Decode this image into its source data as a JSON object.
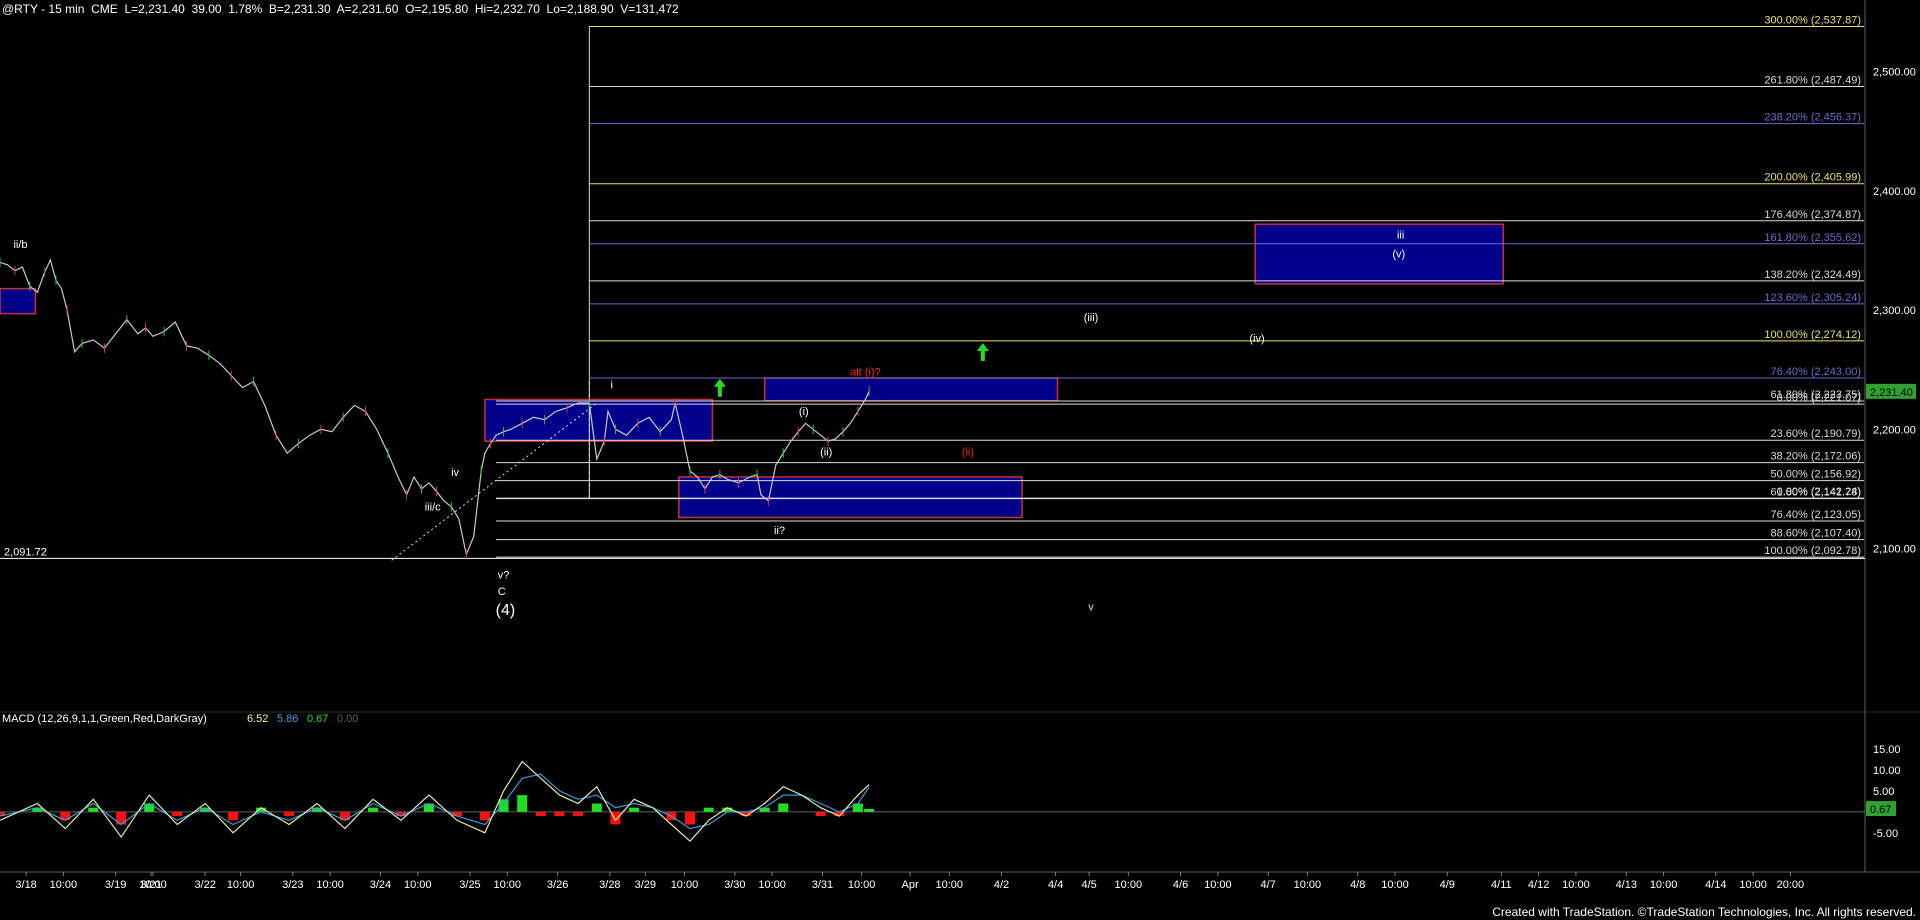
{
  "header": {
    "symbol": "@RTY - 15 min  CME",
    "last": "L=2,231.40",
    "change": "39.00",
    "change_pct": "1.78%",
    "bid": "B=2,231.30",
    "ask": "A=2,231.60",
    "open": "O=2,195.80",
    "high": "Hi=2,232.70",
    "low": "Lo=2,188.90",
    "volume": "V=131,472"
  },
  "footer_text": "Created with TradeStation. ©TradeStation Technologies, Inc. All rights reserved.",
  "colors": {
    "background": "#000000",
    "price_line": "#c8c8c8",
    "box_fill": "#00008b",
    "box_border": "#c83232",
    "fib_white": "#dcdcdc",
    "fib_blue": "#6a6ad0",
    "fib_yellow": "#e8e070",
    "green_arrow": "#22dd22",
    "macd_green": "#22dd22",
    "macd_red": "#ff1010",
    "macd_line": "#e8e8a0",
    "signal_line": "#30a0e0"
  },
  "chart_data": {
    "type": "line",
    "title": "",
    "xlabel": "",
    "ylabel": "",
    "ylim": [
      2040,
      2545
    ],
    "y_ticks": [
      "2,500.00",
      "2,400.00",
      "2,300.00",
      "2,200.00",
      "2,100.00"
    ],
    "y_tick_values": [
      2500,
      2400,
      2300,
      2200,
      2100
    ],
    "last_price_label": "2,231.40",
    "last_price": 2231.4,
    "x_tick_labels": [
      "3/18",
      "10:00",
      "3/19",
      "10:00",
      "3/21",
      "3/22",
      "10:00",
      "3/23",
      "10:00",
      "3/24",
      "10:00",
      "3/25",
      "10:00",
      "3/26",
      "3/28",
      "3/29",
      "10:00",
      "3/30",
      "10:00",
      "3/31",
      "10:00",
      "Apr",
      "10:00",
      "4/2",
      "4/4",
      "4/5",
      "10:00",
      "4/6",
      "10:00",
      "4/7",
      "10:00",
      "4/8",
      "10:00",
      "4/9",
      "4/11",
      "4/12",
      "10:00",
      "4/13",
      "10:00",
      "4/14",
      "10:00",
      "20:00"
    ],
    "x_tick_pos": [
      0.014,
      0.034,
      0.062,
      0.082,
      0.081,
      0.11,
      0.129,
      0.157,
      0.177,
      0.204,
      0.224,
      0.252,
      0.272,
      0.299,
      0.327,
      0.346,
      0.367,
      0.394,
      0.414,
      0.441,
      0.462,
      0.488,
      0.509,
      0.537,
      0.566,
      0.584,
      0.605,
      0.633,
      0.653,
      0.68,
      0.701,
      0.728,
      0.748,
      0.776,
      0.805,
      0.825,
      0.845,
      0.872,
      0.892,
      0.92,
      0.94,
      0.96
    ],
    "price_x": [
      0,
      0.004,
      0.008,
      0.012,
      0.016,
      0.02,
      0.024,
      0.027,
      0.03,
      0.033,
      0.036,
      0.04,
      0.044,
      0.05,
      0.056,
      0.062,
      0.068,
      0.074,
      0.078,
      0.082,
      0.088,
      0.094,
      0.1,
      0.106,
      0.112,
      0.118,
      0.124,
      0.13,
      0.136,
      0.142,
      0.148,
      0.154,
      0.16,
      0.166,
      0.172,
      0.178,
      0.184,
      0.19,
      0.196,
      0.202,
      0.208,
      0.214,
      0.218,
      0.222,
      0.226,
      0.23,
      0.234,
      0.238,
      0.242,
      0.246,
      0.25,
      0.254,
      0.258,
      0.26,
      0.263,
      0.266,
      0.27,
      0.274,
      0.28,
      0.286,
      0.292,
      0.298,
      0.304,
      0.31,
      0.316,
      0.32,
      0.324,
      0.326,
      0.33,
      0.336,
      0.342,
      0.348,
      0.354,
      0.36,
      0.362,
      0.366,
      0.37,
      0.374,
      0.378,
      0.382,
      0.386,
      0.39,
      0.396,
      0.402,
      0.406,
      0.408,
      0.412,
      0.416,
      0.42,
      0.424,
      0.428,
      0.432,
      0.436,
      0.44,
      0.444,
      0.448,
      0.452,
      0.456,
      0.46,
      0.464,
      0.466
    ],
    "price_y": [
      2340,
      2338,
      2333,
      2336,
      2320,
      2315,
      2332,
      2342,
      2325,
      2318,
      2300,
      2265,
      2272,
      2275,
      2268,
      2280,
      2292,
      2280,
      2285,
      2278,
      2282,
      2290,
      2270,
      2268,
      2262,
      2255,
      2245,
      2235,
      2240,
      2220,
      2195,
      2180,
      2188,
      2195,
      2200,
      2198,
      2210,
      2220,
      2215,
      2200,
      2180,
      2158,
      2145,
      2160,
      2150,
      2155,
      2148,
      2140,
      2135,
      2125,
      2095,
      2110,
      2165,
      2180,
      2188,
      2195,
      2198,
      2200,
      2205,
      2210,
      2208,
      2215,
      2218,
      2222,
      2222,
      2175,
      2190,
      2215,
      2200,
      2195,
      2205,
      2210,
      2198,
      2208,
      2222,
      2195,
      2165,
      2160,
      2150,
      2160,
      2162,
      2158,
      2155,
      2160,
      2162,
      2145,
      2140,
      2170,
      2180,
      2190,
      2198,
      2205,
      2200,
      2195,
      2190,
      2192,
      2198,
      2205,
      2215,
      2225,
      2232
    ],
    "fib_levels": [
      {
        "label": "300.00% (2,537.87)",
        "value": 2537.87,
        "color": "#e8e070"
      },
      {
        "label": "261.80% (2,487.49)",
        "value": 2487.49,
        "color": "#dcdcdc"
      },
      {
        "label": "238.20% (2,456.37)",
        "value": 2456.37,
        "color": "#6a6ad0"
      },
      {
        "label": "200.00% (2,405.99)",
        "value": 2405.99,
        "color": "#e8e070"
      },
      {
        "label": "176.40% (2,374.87)",
        "value": 2374.87,
        "color": "#dcdcdc"
      },
      {
        "label": "161.80% (2,355.62)",
        "value": 2355.62,
        "color": "#6a6ad0"
      },
      {
        "label": "138.20% (2,324.49)",
        "value": 2324.49,
        "color": "#dcdcdc"
      },
      {
        "label": "123.60% (2,305.24)",
        "value": 2305.24,
        "color": "#6a6ad0"
      },
      {
        "label": "100.00% (2,274.12)",
        "value": 2274.12,
        "color": "#e8e070"
      },
      {
        "label": "76.40% (2,243.00)",
        "value": 2243.0,
        "color": "#6a6ad0"
      },
      {
        "label": "61.80% (2,223.75)",
        "value": 2223.75,
        "color": "#dcdcdc"
      },
      {
        "label": "0.00% (2,221.07)",
        "value": 2221.07,
        "color": "#dcdcdc"
      },
      {
        "label": "23.60% (2,190.79)",
        "value": 2190.79,
        "color": "#dcdcdc"
      },
      {
        "label": "38.20% (2,172.06)",
        "value": 2172.06,
        "color": "#dcdcdc"
      },
      {
        "label": "50.00% (2,156.92)",
        "value": 2156.92,
        "color": "#dcdcdc"
      },
      {
        "label": "0.00% (2,142.24)",
        "value": 2142.24,
        "color": "#dcdcdc"
      },
      {
        "label": "61.80% (2,141.78)",
        "value": 2141.78,
        "color": "#dcdcdc"
      },
      {
        "label": "76.40% (2,123.05)",
        "value": 2123.05,
        "color": "#dcdcdc"
      },
      {
        "label": "88.60% (2,107.40)",
        "value": 2107.4,
        "color": "#dcdcdc"
      },
      {
        "label": "100.00% (2,092.78)",
        "value": 2092.78,
        "color": "#dcdcdc"
      }
    ],
    "support_line": {
      "label": "2,091.72",
      "value": 2091.72
    },
    "boxes": [
      {
        "x0": 0.0,
        "x1": 0.019,
        "y0": 2297,
        "y1": 2318
      },
      {
        "x0": 0.26,
        "x1": 0.382,
        "y0": 2190,
        "y1": 2225
      },
      {
        "x0": 0.364,
        "x1": 0.548,
        "y0": 2126,
        "y1": 2160
      },
      {
        "x0": 0.41,
        "x1": 0.567,
        "y0": 2224,
        "y1": 2243
      },
      {
        "x0": 0.673,
        "x1": 0.806,
        "y0": 2322,
        "y1": 2372
      }
    ],
    "wave_labels": [
      {
        "text": "ii/b",
        "x": 0.011,
        "y": 2352,
        "color": "#ffffff"
      },
      {
        "text": "iv",
        "x": 0.244,
        "y": 2161,
        "color": "#ffffff"
      },
      {
        "text": "iii/c",
        "x": 0.232,
        "y": 2132,
        "color": "#ffffff"
      },
      {
        "text": "v?",
        "x": 0.27,
        "y": 2075,
        "color": "#ffffff"
      },
      {
        "text": "C",
        "x": 0.269,
        "y": 2061,
        "color": "#ffffff"
      },
      {
        "text": "(4)",
        "x": 0.271,
        "y": 2044,
        "color": "#ffffff"
      },
      {
        "text": "i",
        "x": 0.328,
        "y": 2234,
        "color": "#ffffff"
      },
      {
        "text": "alt (i)?",
        "x": 0.464,
        "y": 2245,
        "color": "#ff2020"
      },
      {
        "text": "(i)",
        "x": 0.431,
        "y": 2212,
        "color": "#ffffff"
      },
      {
        "text": "(ii)",
        "x": 0.443,
        "y": 2178,
        "color": "#ffffff"
      },
      {
        "text": "(ii)",
        "x": 0.519,
        "y": 2178,
        "color": "#ff2020"
      },
      {
        "text": "ii?",
        "x": 0.418,
        "y": 2112,
        "color": "#ffffff"
      },
      {
        "text": "(iii)",
        "x": 0.585,
        "y": 2291,
        "color": "#ffffff"
      },
      {
        "text": "(iv)",
        "x": 0.674,
        "y": 2273,
        "color": "#ffffff"
      },
      {
        "text": "iii",
        "x": 0.751,
        "y": 2360,
        "color": "#ffffff"
      },
      {
        "text": "(v)",
        "x": 0.75,
        "y": 2344,
        "color": "#ffffff"
      },
      {
        "text": "v",
        "x": 0.585,
        "y": 2048,
        "color": "#e8e070"
      }
    ],
    "arrows": [
      {
        "x": 0.386,
        "y": 2234
      },
      {
        "x": 0.527,
        "y": 2264
      }
    ],
    "macd": {
      "legend": "MACD (12,26,9,1,1,Green,Red,DarkGray)",
      "values_text": [
        "6.52",
        "5.86",
        "0.67",
        "0.00"
      ],
      "ylim": [
        -11,
        20
      ],
      "y_ticks": [
        "15.00",
        "10.00",
        "5.00",
        "-5.00"
      ],
      "y_tick_values": [
        15,
        10,
        5,
        -5
      ],
      "last_label": "0.67",
      "last_value": 0.67,
      "x": [
        0,
        0.02,
        0.035,
        0.05,
        0.065,
        0.08,
        0.095,
        0.11,
        0.125,
        0.14,
        0.155,
        0.17,
        0.185,
        0.2,
        0.215,
        0.23,
        0.245,
        0.26,
        0.27,
        0.28,
        0.29,
        0.3,
        0.31,
        0.32,
        0.33,
        0.34,
        0.35,
        0.36,
        0.37,
        0.38,
        0.39,
        0.4,
        0.41,
        0.42,
        0.43,
        0.44,
        0.45,
        0.46,
        0.466
      ],
      "macd_line": [
        -2,
        2,
        -4,
        3,
        -6,
        4,
        -3,
        2,
        -5,
        1,
        -3,
        2,
        -4,
        3,
        -2,
        4,
        -2,
        -5,
        5,
        12,
        8,
        4,
        2,
        6,
        -2,
        3,
        1,
        -3,
        -7,
        -2,
        1,
        -1,
        2,
        6,
        4,
        1,
        -1,
        4,
        6.5
      ],
      "signal_line": [
        -1,
        1,
        -2,
        2,
        -3,
        2,
        -2,
        1,
        -3,
        0,
        -2,
        1,
        -2,
        2,
        -1,
        2,
        -1,
        -3,
        2,
        8,
        9,
        5,
        3,
        4,
        1,
        2,
        1,
        -1,
        -4,
        -3,
        0,
        0,
        1,
        4,
        4,
        2,
        0,
        2,
        5.9
      ],
      "histogram": [
        -1,
        1,
        -2,
        1,
        -3,
        2,
        -1,
        1,
        -2,
        1,
        -1,
        1,
        -2,
        1,
        -1,
        2,
        -1,
        -2,
        3,
        4,
        -1,
        -1,
        -1,
        2,
        -3,
        1,
        0,
        -2,
        -3,
        1,
        1,
        -1,
        1,
        2,
        0,
        -1,
        -1,
        2,
        0.7
      ]
    }
  }
}
